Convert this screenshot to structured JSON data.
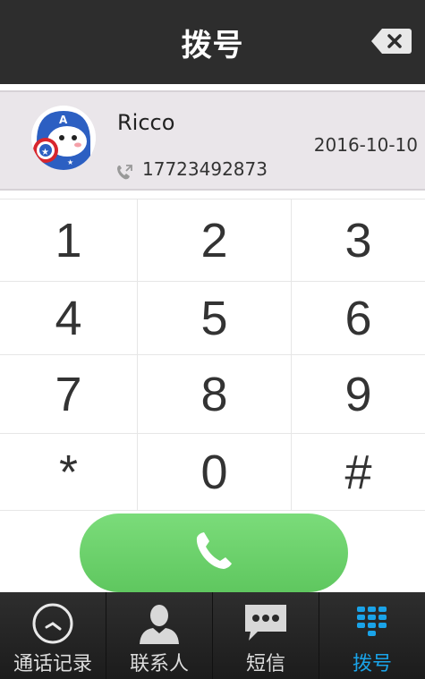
{
  "header": {
    "title": "拨号"
  },
  "contact": {
    "name": "Ricco",
    "date": "2016-10-10",
    "number": "17723492873"
  },
  "keypad": {
    "rows": [
      [
        "1",
        "2",
        "3"
      ],
      [
        "4",
        "5",
        "6"
      ],
      [
        "7",
        "8",
        "9"
      ],
      [
        "*",
        "0",
        "#"
      ]
    ]
  },
  "tabs": [
    {
      "label": "通话记录",
      "icon": "clock-icon"
    },
    {
      "label": "联系人",
      "icon": "person-icon"
    },
    {
      "label": "短信",
      "icon": "message-icon"
    },
    {
      "label": "拨号",
      "icon": "dialpad-icon",
      "active": true
    }
  ],
  "colors": {
    "header_bg": "#2d2d2d",
    "call_green": "#6ad46a",
    "active_tab": "#1aa3e8"
  }
}
